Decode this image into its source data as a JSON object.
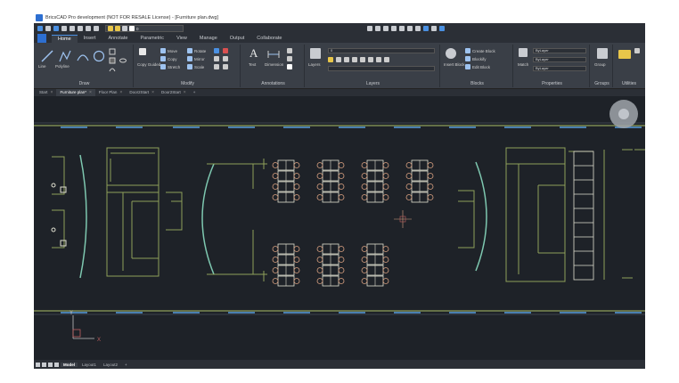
{
  "window": {
    "title": "BricsCAD Pro development (NOT FOR RESALE License) - [Furniture plan.dwg]"
  },
  "quick_access": {
    "current_layer": "0"
  },
  "ribbon_tabs": [
    {
      "label": "Home",
      "active": true
    },
    {
      "label": "Insert"
    },
    {
      "label": "Annotate"
    },
    {
      "label": "Parametric"
    },
    {
      "label": "View"
    },
    {
      "label": "Manage"
    },
    {
      "label": "Output"
    },
    {
      "label": "Collaborate"
    }
  ],
  "ribbon": {
    "draw": {
      "label": "Draw",
      "line": "Line",
      "polyline": "Polyline"
    },
    "modify": {
      "label": "Modify",
      "move": "Move",
      "rotate": "Rotate",
      "copy": "Copy",
      "mirror": "Mirror",
      "stretch": "Stretch",
      "scale": "Scale",
      "copy_guided": "Copy Guided"
    },
    "annotations": {
      "label": "Annotations",
      "text": "Text",
      "dimension": "Dimension"
    },
    "layers": {
      "label": "Layers",
      "layers_button": "Layers",
      "current": "0"
    },
    "blocks": {
      "label": "Blocks",
      "insert": "Insert Block",
      "create": "Create Block",
      "blockify": "Blockify",
      "edit": "Edit Block"
    },
    "properties": {
      "label": "Properties",
      "match": "Match",
      "color": "ByLayer",
      "linetype": "ByLayer",
      "lineweight": "ByLayer"
    },
    "groups": {
      "label": "Groups",
      "group": "Group"
    },
    "utilities": {
      "label": "Utilities"
    }
  },
  "doc_tabs": [
    {
      "label": "Start"
    },
    {
      "label": "Furniture plan*",
      "active": true
    },
    {
      "label": "Floor Plan"
    },
    {
      "label": "Door2Start"
    },
    {
      "label": "Door2Start"
    }
  ],
  "layout_tabs": [
    {
      "label": "Model",
      "active": true
    },
    {
      "label": "Layout1"
    },
    {
      "label": "Layout2"
    }
  ],
  "ucs": {
    "x_label": "X",
    "y_label": "Y"
  },
  "colors": {
    "canvas": "#1e2228",
    "ribbon": "#3a3f47",
    "accent": "#4a90e2",
    "wall": "#8fa05a",
    "furniture": "#e0e0d0",
    "chair": "#d8a080",
    "glass": "#7ec8b0"
  }
}
